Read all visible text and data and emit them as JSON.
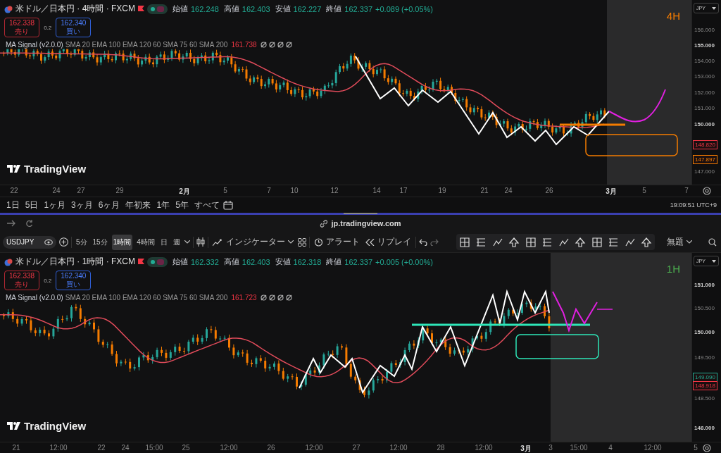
{
  "top_chart": {
    "symbol_title": "米ドル／日本円 · 4時間 · FXCM",
    "ohlc": [
      {
        "label": "始値",
        "value": "162.248"
      },
      {
        "label": "高値",
        "value": "162.403"
      },
      {
        "label": "安値",
        "value": "162.227"
      },
      {
        "label": "終値",
        "value": "162.337"
      }
    ],
    "change": "+0.089 (+0.05%)",
    "sell": {
      "price": "162.338",
      "label": "売り"
    },
    "spread": "0.2",
    "buy": {
      "price": "162.340",
      "label": "買い"
    },
    "indicator": {
      "name": "MA Signal (v2.0.0)",
      "params": "SMA 20 EMA 100 EMA 120 60 SMA 75 60 SMA 200",
      "value": "161.738"
    },
    "timeframe_label": "4H",
    "currency": "JPY",
    "logo": "TradingView",
    "price_ticks": [
      {
        "label": "156.000",
        "bold": false
      },
      {
        "label": "155.000",
        "bold": true
      },
      {
        "label": "154.000",
        "bold": false
      },
      {
        "label": "153.000",
        "bold": false
      },
      {
        "label": "152.000",
        "bold": false
      },
      {
        "label": "151.000",
        "bold": false
      },
      {
        "label": "150.000",
        "bold": true
      },
      {
        "label": "147.000",
        "bold": false
      }
    ],
    "price_badges": [
      {
        "label": "148.820",
        "color": "#f23645"
      },
      {
        "label": "147.897",
        "color": "#f57c00"
      }
    ],
    "time_ticks": [
      {
        "label": "22",
        "bold": false
      },
      {
        "label": "24",
        "bold": false
      },
      {
        "label": "27",
        "bold": false
      },
      {
        "label": "29",
        "bold": false
      },
      {
        "label": "2月",
        "bold": true
      },
      {
        "label": "5",
        "bold": false
      },
      {
        "label": "7",
        "bold": false
      },
      {
        "label": "10",
        "bold": false
      },
      {
        "label": "12",
        "bold": false
      },
      {
        "label": "14",
        "bold": false
      },
      {
        "label": "17",
        "bold": false
      },
      {
        "label": "19",
        "bold": false
      },
      {
        "label": "21",
        "bold": false
      },
      {
        "label": "24",
        "bold": false
      },
      {
        "label": "26",
        "bold": false
      },
      {
        "label": "3月",
        "bold": true
      },
      {
        "label": "5",
        "bold": false
      },
      {
        "label": "7",
        "bold": false
      }
    ]
  },
  "range_bar": {
    "ranges": [
      "1日",
      "5日",
      "1ヶ月",
      "3ヶ月",
      "6ヶ月",
      "年初来",
      "1年",
      "5年",
      "すべて"
    ],
    "clock": "19:09:51 UTC+9"
  },
  "browser": {
    "url": "jp.tradingview.com"
  },
  "toolbar": {
    "symbol": "USDJPY",
    "intervals": [
      {
        "label": "5分",
        "selected": false
      },
      {
        "label": "15分",
        "selected": false
      },
      {
        "label": "1時間",
        "selected": true
      },
      {
        "label": "4時間",
        "selected": false
      },
      {
        "label": "日",
        "selected": false
      },
      {
        "label": "週",
        "selected": false
      }
    ],
    "indicators": "インジケーター",
    "alert": "アラート",
    "replay": "リプレイ",
    "layout_name": "無題"
  },
  "bottom_chart": {
    "symbol_title": "米ドル／日本円 · 1時間 · FXCM",
    "ohlc": [
      {
        "label": "始値",
        "value": "162.332"
      },
      {
        "label": "高値",
        "value": "162.403"
      },
      {
        "label": "安値",
        "value": "162.318"
      },
      {
        "label": "終値",
        "value": "162.337"
      }
    ],
    "change": "+0.005 (+0.00%)",
    "sell": {
      "price": "162.338",
      "label": "売り"
    },
    "spread": "0.2",
    "buy": {
      "price": "162.340",
      "label": "買い"
    },
    "indicator": {
      "name": "MA Signal (v2.0.0)",
      "params": "SMA 20 EMA 100 EMA 120 60 SMA 75 60 SMA 200",
      "value": "161.723"
    },
    "timeframe_label": "1H",
    "currency": "JPY",
    "logo": "TradingView",
    "price_ticks": [
      {
        "label": "151.000",
        "bold": true
      },
      {
        "label": "150.500",
        "bold": false
      },
      {
        "label": "150.000",
        "bold": true
      },
      {
        "label": "149.500",
        "bold": false
      },
      {
        "label": "148.500",
        "bold": false
      },
      {
        "label": "148.000",
        "bold": true
      }
    ],
    "price_badges": [
      {
        "label": "149.090",
        "color": "#22ab94"
      },
      {
        "label": "148.918",
        "color": "#f23645"
      }
    ],
    "time_ticks": [
      {
        "label": "21",
        "bold": false
      },
      {
        "label": "12:00",
        "bold": false
      },
      {
        "label": "22",
        "bold": false
      },
      {
        "label": "24",
        "bold": false
      },
      {
        "label": "15:00",
        "bold": false
      },
      {
        "label": "25",
        "bold": false
      },
      {
        "label": "12:00",
        "bold": false
      },
      {
        "label": "26",
        "bold": false
      },
      {
        "label": "12:00",
        "bold": false
      },
      {
        "label": "27",
        "bold": false
      },
      {
        "label": "12:00",
        "bold": false
      },
      {
        "label": "28",
        "bold": false
      },
      {
        "label": "12:00",
        "bold": false
      },
      {
        "label": "3月",
        "bold": true
      },
      {
        "label": "3",
        "bold": false
      },
      {
        "label": "15:00",
        "bold": false
      },
      {
        "label": "4",
        "bold": false
      },
      {
        "label": "12:00",
        "bold": false
      },
      {
        "label": "5",
        "bold": false
      }
    ]
  }
}
